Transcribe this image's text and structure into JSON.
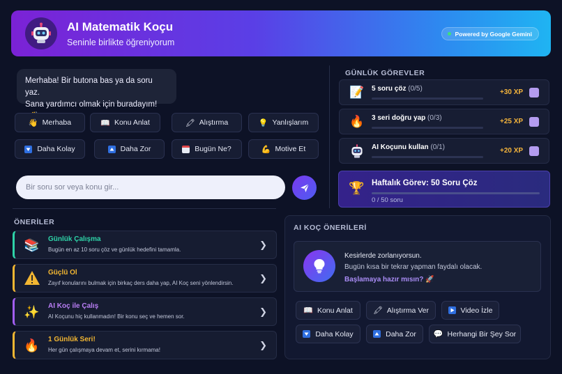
{
  "header": {
    "title": "AI Matematik Koçu",
    "subtitle": "Seninle birlikte öğreniyorum",
    "powered_by": "Powered by Google Gemini"
  },
  "chat": {
    "greeting_line1": "Merhaba! Bir butona bas ya da soru yaz.",
    "greeting_line2": "Sana yardımcı olmak için buradayım!",
    "greeting_emoji": "👋",
    "input_placeholder": "Bir soru sor veya konu gir...",
    "quick_buttons": [
      {
        "label": "Merhaba",
        "icon": "👋"
      },
      {
        "label": "Konu Anlat",
        "icon": "📖"
      },
      {
        "label": "Alıştırma",
        "icon": "🖍"
      },
      {
        "label": "Yanlışlarım",
        "icon": "💡"
      },
      {
        "label": "Daha Kolay",
        "icon": "down-square"
      },
      {
        "label": "Daha Zor",
        "icon": "up-square"
      },
      {
        "label": "Bugün Ne?",
        "icon": "calendar"
      },
      {
        "label": "Motive Et",
        "icon": "💪"
      }
    ]
  },
  "daily": {
    "title": "GÜNLÜK GÖREVLER",
    "tasks": [
      {
        "name": "5 soru çöz",
        "count": "(0/5)",
        "xp": "+30 XP",
        "icon": "📝",
        "progress": 0
      },
      {
        "name": "3 seri doğru yap",
        "count": "(0/3)",
        "xp": "+25 XP",
        "icon": "🔥",
        "progress": 0
      },
      {
        "name": "AI Koçunu kullan",
        "count": "(0/1)",
        "xp": "+20 XP",
        "icon": "robot",
        "progress": 0
      }
    ],
    "weekly": {
      "title": "Haftalık Görev: 50 Soru Çöz",
      "count": "0 / 50 soru",
      "icon": "🏆",
      "progress": 0
    }
  },
  "suggestions": {
    "title": "ÖNERİLER",
    "items": [
      {
        "title": "Günlük Çalışma",
        "desc": "Bugün en az 10 soru çöz ve günlük hedefini tamamla.",
        "icon": "📚",
        "color": "#2ed3a8"
      },
      {
        "title": "Güçlü Ol",
        "desc": "Zayıf konularını bulmak için birkaç ders daha yap, AI Koç seni yönlendirsin.",
        "icon": "⚠",
        "color": "#f2b632"
      },
      {
        "title": "AI Koç ile Çalış",
        "desc": "AI Koçunu hiç kullanmadın! Bir konu seç ve hemen sor.",
        "icon": "✨",
        "color": "#a25ef2"
      },
      {
        "title": "1 Günlük Seri!",
        "desc": "Her gün çalışmaya devam et, serini kırmama!",
        "icon": "🔥",
        "color": "#f2b632"
      }
    ]
  },
  "ai_coach": {
    "title": "AI KOÇ ÖNERİLERİ",
    "line1": "Kesirlerde zorlanıyorsun.",
    "line2": "Bugün kısa bir tekrar yapman faydalı olacak.",
    "cta": "Başlamaya hazır mısın? 🚀",
    "buttons": [
      {
        "label": "Konu Anlat",
        "icon": "📖"
      },
      {
        "label": "Alıştırma Ver",
        "icon": "🖍"
      },
      {
        "label": "Video İzle",
        "icon": "play-square"
      },
      {
        "label": "Daha Kolay",
        "icon": "down-square"
      },
      {
        "label": "Daha Zor",
        "icon": "up-square"
      },
      {
        "label": "Herhangi Bir Şey Sor",
        "icon": "💬"
      }
    ]
  }
}
